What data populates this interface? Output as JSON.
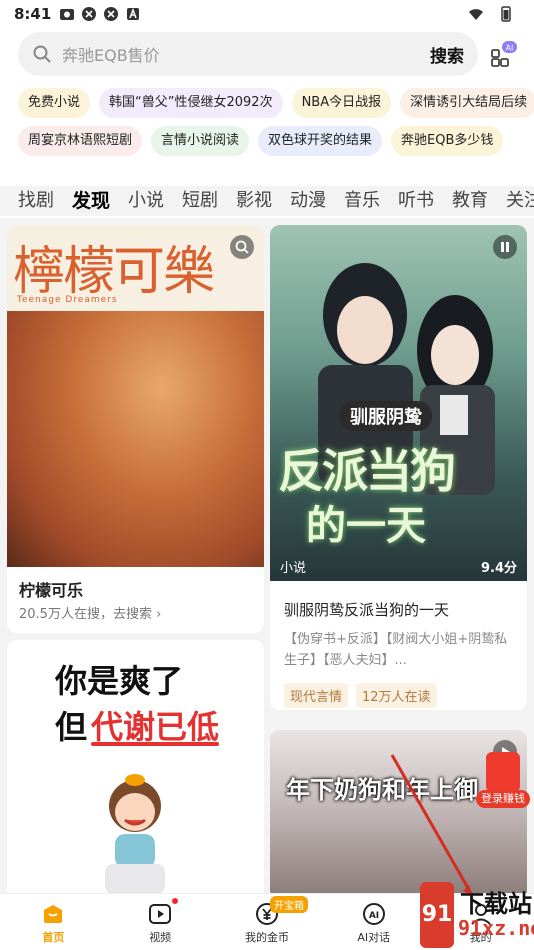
{
  "status": {
    "time": "8:41"
  },
  "search": {
    "placeholder": "奔驰EQB售价",
    "button": "搜索"
  },
  "chips_row1": [
    "免费小说",
    "韩国“兽父”性侵继女2092次",
    "NBA今日战报",
    "深情诱引大结局后续"
  ],
  "chips_row2": [
    "周宴京林语熙短剧",
    "言情小说阅读",
    "双色球开奖的结果",
    "奔驰EQB多少钱"
  ],
  "chip_colors_row1": [
    "#fbf4d8",
    "#f2ebfb",
    "#fbf4d8",
    "#fbefe6"
  ],
  "chip_colors_row2": [
    "#fbecec",
    "#e8f5ea",
    "#e9ecfb",
    "#fbf4d8"
  ],
  "tabs": [
    "找剧",
    "发现",
    "小说",
    "短剧",
    "影视",
    "动漫",
    "音乐",
    "听书",
    "教育",
    "关注"
  ],
  "cards": {
    "c1": {
      "poster_title": "檸檬可樂",
      "poster_sub": "Teenage Dreamers",
      "title": "柠檬可乐",
      "sub": "20.5万人在搜，去搜索 ›"
    },
    "c2": {
      "cover_t1": "驯服阴鸷",
      "cover_t2": "反派当狗",
      "cover_t3": "的一天",
      "tag": "小说",
      "score": "9.4分",
      "title": "驯服阴鸷反派当狗的一天",
      "desc": "【伪穿书+反派】【财阀大小姐+阴鸷私生子】【恶人夫妇】...",
      "pill1": "现代言情",
      "pill2": "12万人在读"
    },
    "c3": {
      "line1": "你是爽了",
      "line2a": "但",
      "line2b": "代谢已低"
    },
    "c4": {
      "caption": "年下奶狗和年上御"
    }
  },
  "float": {
    "label": "登录赚钱"
  },
  "bottom_nav": [
    {
      "label": "首页"
    },
    {
      "label": "视频"
    },
    {
      "label": "我的金币"
    },
    {
      "label": "AI对话"
    },
    {
      "label": "我的"
    }
  ],
  "badge_box": "开宝箱",
  "watermark": {
    "t1": "下载站",
    "t2": "91xz.net",
    "mark": "91"
  },
  "colors": {
    "accent": "#f5a200",
    "red": "#e63131"
  }
}
